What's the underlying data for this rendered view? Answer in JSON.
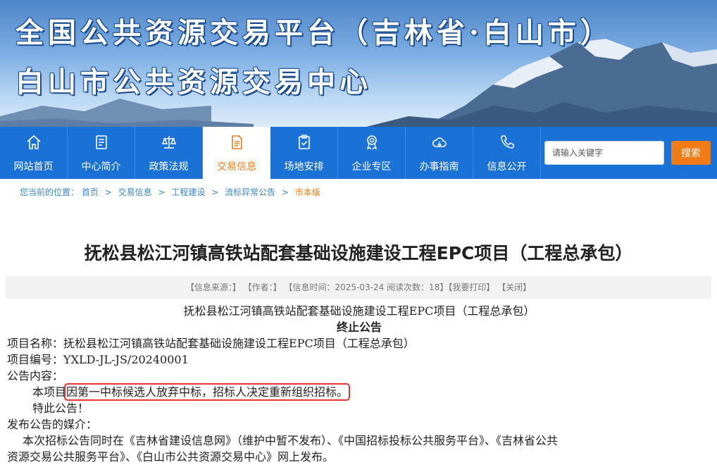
{
  "banner": {
    "title_line1": "全国公共资源交易平台（吉林省·白山市）",
    "title_line2": "白山市公共资源交易中心"
  },
  "nav": {
    "items": [
      {
        "label": "网站首页",
        "icon": "home-icon"
      },
      {
        "label": "中心简介",
        "icon": "document-icon"
      },
      {
        "label": "政策法规",
        "icon": "scales-icon"
      },
      {
        "label": "交易信息",
        "icon": "file-list-icon"
      },
      {
        "label": "场地安排",
        "icon": "clipboard-check-icon"
      },
      {
        "label": "企业专区",
        "icon": "award-icon"
      },
      {
        "label": "办事指南",
        "icon": "cloud-icon"
      },
      {
        "label": "信息公开",
        "icon": "phone-icon"
      }
    ],
    "active_index": 3
  },
  "search": {
    "placeholder": "请输入关键字",
    "button_label": "搜索"
  },
  "breadcrumb": {
    "prefix": "您当前的位置：",
    "items": [
      "首页",
      "交易信息",
      "工程建设",
      "流标异常公告"
    ],
    "current": "市本级",
    "separator": ">"
  },
  "article": {
    "title": "抚松县松江河镇高铁站配套基础设施建设工程EPC项目（工程总承包）",
    "meta": {
      "source": "【信息来源：】",
      "author": "【作者：】",
      "time": "【信息时间：2025-03-24 阅读次数：18】",
      "print": "【我要打印】",
      "close": "【关闭】"
    },
    "header_line": "抚松县松江河镇高铁站配套基础设施建设工程EPC项目（工程总承包）",
    "notice_title": "终止公告",
    "project_name": "项目名称：抚松县松江河镇高铁站配套基础设施建设工程EPC项目（工程总承包）",
    "project_code": "项目编号：YXLD-JL-JS/20240001",
    "content_label": "公告内容：",
    "content_prefix": "本项目",
    "content_highlight": "因第一中标候选人放弃中标，招标人决定重新组织招标。",
    "special_notice": "特此公告！",
    "media_label": "发布公告的媒介：",
    "media_line1": "本次招标公告同时在《吉林省建设信息网》（维护中暂不发布）、《中国招标投标公共服务平台》、《吉林省公共",
    "media_line2": "资源交易公共服务平台》、《白山市公共资源交易中心》网上发布。"
  }
}
